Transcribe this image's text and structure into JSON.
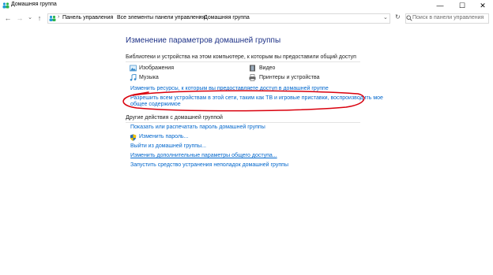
{
  "window": {
    "title": "Домашняя группа",
    "minimize_glyph": "—",
    "maximize_glyph": "☐",
    "close_glyph": "✕"
  },
  "nav": {
    "back_glyph": "←",
    "forward_glyph": "→",
    "dropdown_glyph": "⌄",
    "up_glyph": "↑",
    "refresh_glyph": "↻"
  },
  "address": {
    "separator": "›",
    "crumbs": [
      "Панель управления",
      "Все элементы панели управления",
      "Домашняя группа"
    ]
  },
  "search": {
    "placeholder": "Поиск в панели управления"
  },
  "main": {
    "heading": "Изменение параметров домашней группы",
    "shared_section": "Библиотеки и устройства на этом компьютере, к которым вы предоставили общий доступ",
    "libraries": {
      "images": "Изображения",
      "video": "Видео",
      "music": "Музыка",
      "printers": "Принтеры и устройства"
    },
    "change_resources_link": "Изменить ресурсы, к которым вы предоставляете доступ в домашней группе",
    "allow_devices_link_line1": "Разрешить всем устройствам в этой сети, таким как ТВ и игровые приставки, воспроизводить мое",
    "allow_devices_link_line2": "общее содержимое",
    "other_section": "Другие действия с домашней группой",
    "actions": {
      "show_password": "Показать или распечатать пароль домашней группы",
      "change_password": "Изменить пароль...",
      "leave": "Выйти из домашней группы...",
      "advanced_sharing": "Изменить дополнительные параметры общего доступа...",
      "troubleshooter": "Запустить средство устранения неполадок домашней группы"
    }
  },
  "colors": {
    "heading": "#1e3287",
    "link": "#0066cc",
    "annotation": "#d9000d"
  }
}
